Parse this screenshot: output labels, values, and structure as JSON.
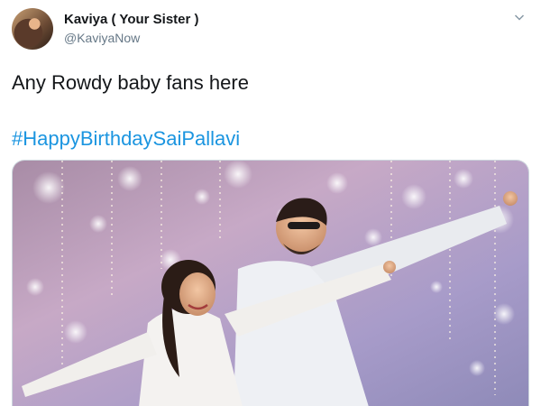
{
  "tweet": {
    "author": {
      "display_name": "Kaviya ( Your Sister )",
      "handle": "@KaviyaNow"
    },
    "text": "Any Rowdy baby fans here",
    "hashtag": "#HappyBirthdaySaiPallavi"
  },
  "icons": {
    "menu": "chevron-down-icon"
  },
  "colors": {
    "hashtag": "#1b95e0",
    "handle": "#657786",
    "text": "#14171a"
  }
}
